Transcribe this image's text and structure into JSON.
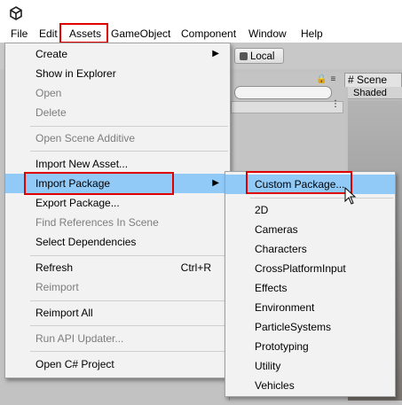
{
  "menubar": {
    "items": [
      "File",
      "Edit",
      "Assets",
      "GameObject",
      "Component",
      "Window",
      "Help"
    ]
  },
  "toolbar": {
    "local_label": "Local"
  },
  "scene_panel": {
    "tab_label": "Scene",
    "shading_label": "Shaded"
  },
  "assets_menu": {
    "items": [
      {
        "label": "Create",
        "submenu": true
      },
      {
        "label": "Show in Explorer"
      },
      {
        "label": "Open",
        "disabled": true
      },
      {
        "label": "Delete",
        "disabled": true
      },
      {
        "label": "Open Scene Additive",
        "disabled": true
      },
      {
        "label": "Import New Asset..."
      },
      {
        "label": "Import Package",
        "submenu": true,
        "highlighted": true
      },
      {
        "label": "Export Package..."
      },
      {
        "label": "Find References In Scene",
        "disabled": true
      },
      {
        "label": "Select Dependencies"
      },
      {
        "label": "Refresh",
        "shortcut": "Ctrl+R"
      },
      {
        "label": "Reimport",
        "disabled": true
      },
      {
        "label": "Reimport All"
      },
      {
        "label": "Run API Updater...",
        "disabled": true
      },
      {
        "label": "Open C# Project"
      }
    ]
  },
  "import_package_menu": {
    "items": [
      {
        "label": "Custom Package...",
        "highlighted": true
      },
      {
        "label": "2D"
      },
      {
        "label": "Cameras"
      },
      {
        "label": "Characters"
      },
      {
        "label": "CrossPlatformInput"
      },
      {
        "label": "Effects"
      },
      {
        "label": "Environment"
      },
      {
        "label": "ParticleSystems"
      },
      {
        "label": "Prototyping"
      },
      {
        "label": "Utility"
      },
      {
        "label": "Vehicles"
      }
    ]
  },
  "colors": {
    "highlight": "#91c9f7",
    "annotation_red": "#e00000"
  }
}
